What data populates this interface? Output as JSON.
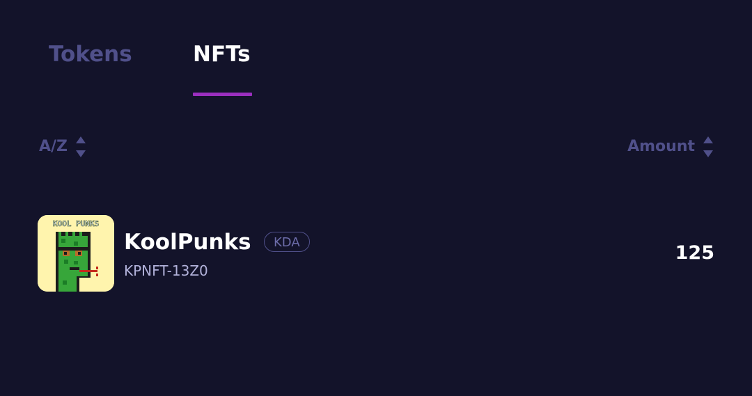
{
  "tabs": [
    {
      "label": "Tokens",
      "active": false
    },
    {
      "label": "NFTs",
      "active": true
    }
  ],
  "sort": {
    "name_label": "A/Z",
    "amount_label": "Amount"
  },
  "nft_list": [
    {
      "name": "KoolPunks",
      "badge": "KDA",
      "id": "KPNFT-13Z0",
      "amount": "125",
      "thumbnail_text": "KOOL PUNKS"
    }
  ],
  "colors": {
    "background": "#13132a",
    "accent": "#9b2fbf",
    "muted": "#50508a",
    "active_text": "#ffffff",
    "subtext": "#b2b2da"
  },
  "icons": {
    "sort_name": "sort-arrows-icon",
    "sort_amount": "sort-arrows-icon"
  }
}
